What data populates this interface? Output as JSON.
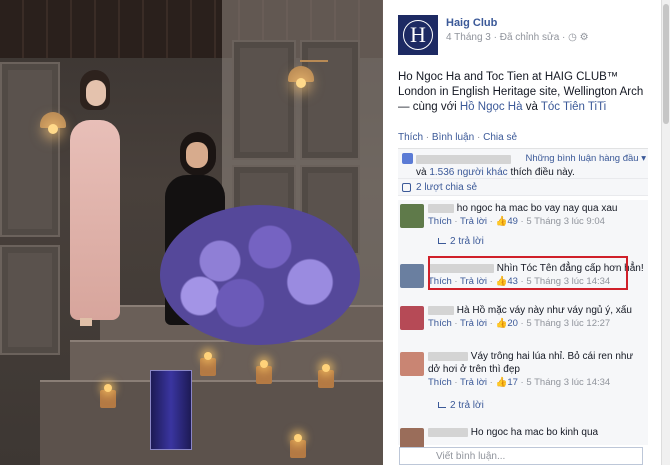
{
  "page": {
    "name": "Haig Club",
    "logo_letter": "H",
    "date": "4 Tháng 3",
    "edited": "Đã chỉnh sửa"
  },
  "post": {
    "text_a": "Ho Ngoc Ha and Toc Tien at HAIG CLUB™ London in English Heritage site, Wellington Arch — cùng với ",
    "tag1": "Hồ Ngọc Hà",
    "text_and": " và ",
    "tag2": "Tóc Tiên TiTi"
  },
  "actions": {
    "like": "Thích",
    "comment": "Bình luận",
    "share": "Chia sẻ"
  },
  "summary": {
    "best_filter": "Những bình luận hàng đầu ▾",
    "likes_and": "và",
    "likes_count": "1.536 người khác",
    "likes_suffix": "thích điều này.",
    "shares": "2 lượt chia sẻ"
  },
  "comments": [
    {
      "text": "ho ngoc ha mac bo vay nay qua xau",
      "like": "Thích",
      "reply": "Trả lời",
      "likes": "49",
      "time": "5 Tháng 3 lúc 9:04",
      "replies": "2 trả lời"
    },
    {
      "text": "Nhìn Tóc Tên đẳng cấp hơn hẳn!",
      "like": "Thích",
      "reply": "Trả lời",
      "likes": "43",
      "time": "5 Tháng 3 lúc 14:34"
    },
    {
      "text": "Hà Hồ mặc váy này như váy ngủ ý, xấu",
      "like": "Thích",
      "reply": "Trả lời",
      "likes": "20",
      "time": "5 Tháng 3 lúc 12:27"
    },
    {
      "text": "Váy trông hai lúa nhỉ. Bỏ cái ren như dở hơi ở trên thì đẹp",
      "like": "Thích",
      "reply": "Trả lời",
      "likes": "17",
      "time": "5 Tháng 3 lúc 14:34",
      "replies": "2 trả lời"
    },
    {
      "text": "Ho ngoc ha mac bo kinh qua"
    }
  ],
  "input": {
    "placeholder": "Viết bình luận..."
  },
  "colors": {
    "brand": "#3b5998",
    "highlight": "#d0202a",
    "logo_bg": "#1d2a63"
  }
}
